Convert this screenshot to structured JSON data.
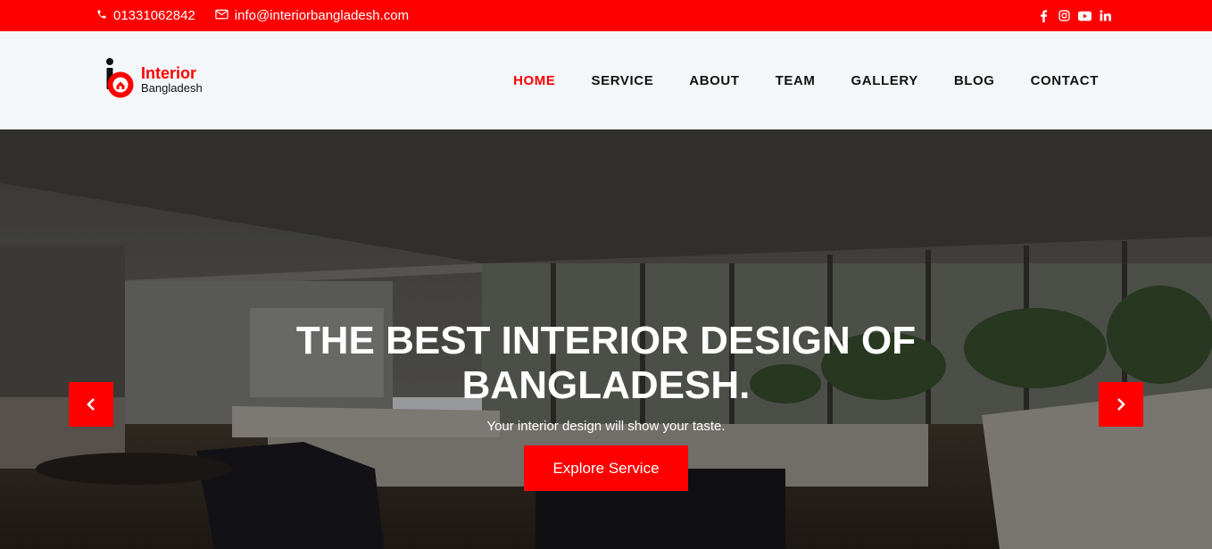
{
  "topbar": {
    "phone": "01331062842",
    "email": "info@interiorbangladesh.com",
    "social_icons": [
      "facebook-icon",
      "instagram-icon",
      "youtube-icon",
      "linkedin-icon"
    ]
  },
  "logo": {
    "line1": "Interior",
    "line2": "Bangladesh"
  },
  "nav": {
    "items": [
      {
        "label": "HOME",
        "active": true
      },
      {
        "label": "SERVICE",
        "active": false
      },
      {
        "label": "ABOUT",
        "active": false
      },
      {
        "label": "TEAM",
        "active": false
      },
      {
        "label": "GALLERY",
        "active": false
      },
      {
        "label": "BLOG",
        "active": false
      },
      {
        "label": "CONTACT",
        "active": false
      }
    ]
  },
  "hero": {
    "headline_line1": "THE BEST INTERIOR DESIGN OF",
    "headline_line2": "BANGLADESH.",
    "subtitle": "Your interior design will show your taste.",
    "cta_label": "Explore Service"
  },
  "colors": {
    "brand_red": "#ff0000",
    "header_bg": "#f4f7fa",
    "text_dark": "#111111"
  }
}
